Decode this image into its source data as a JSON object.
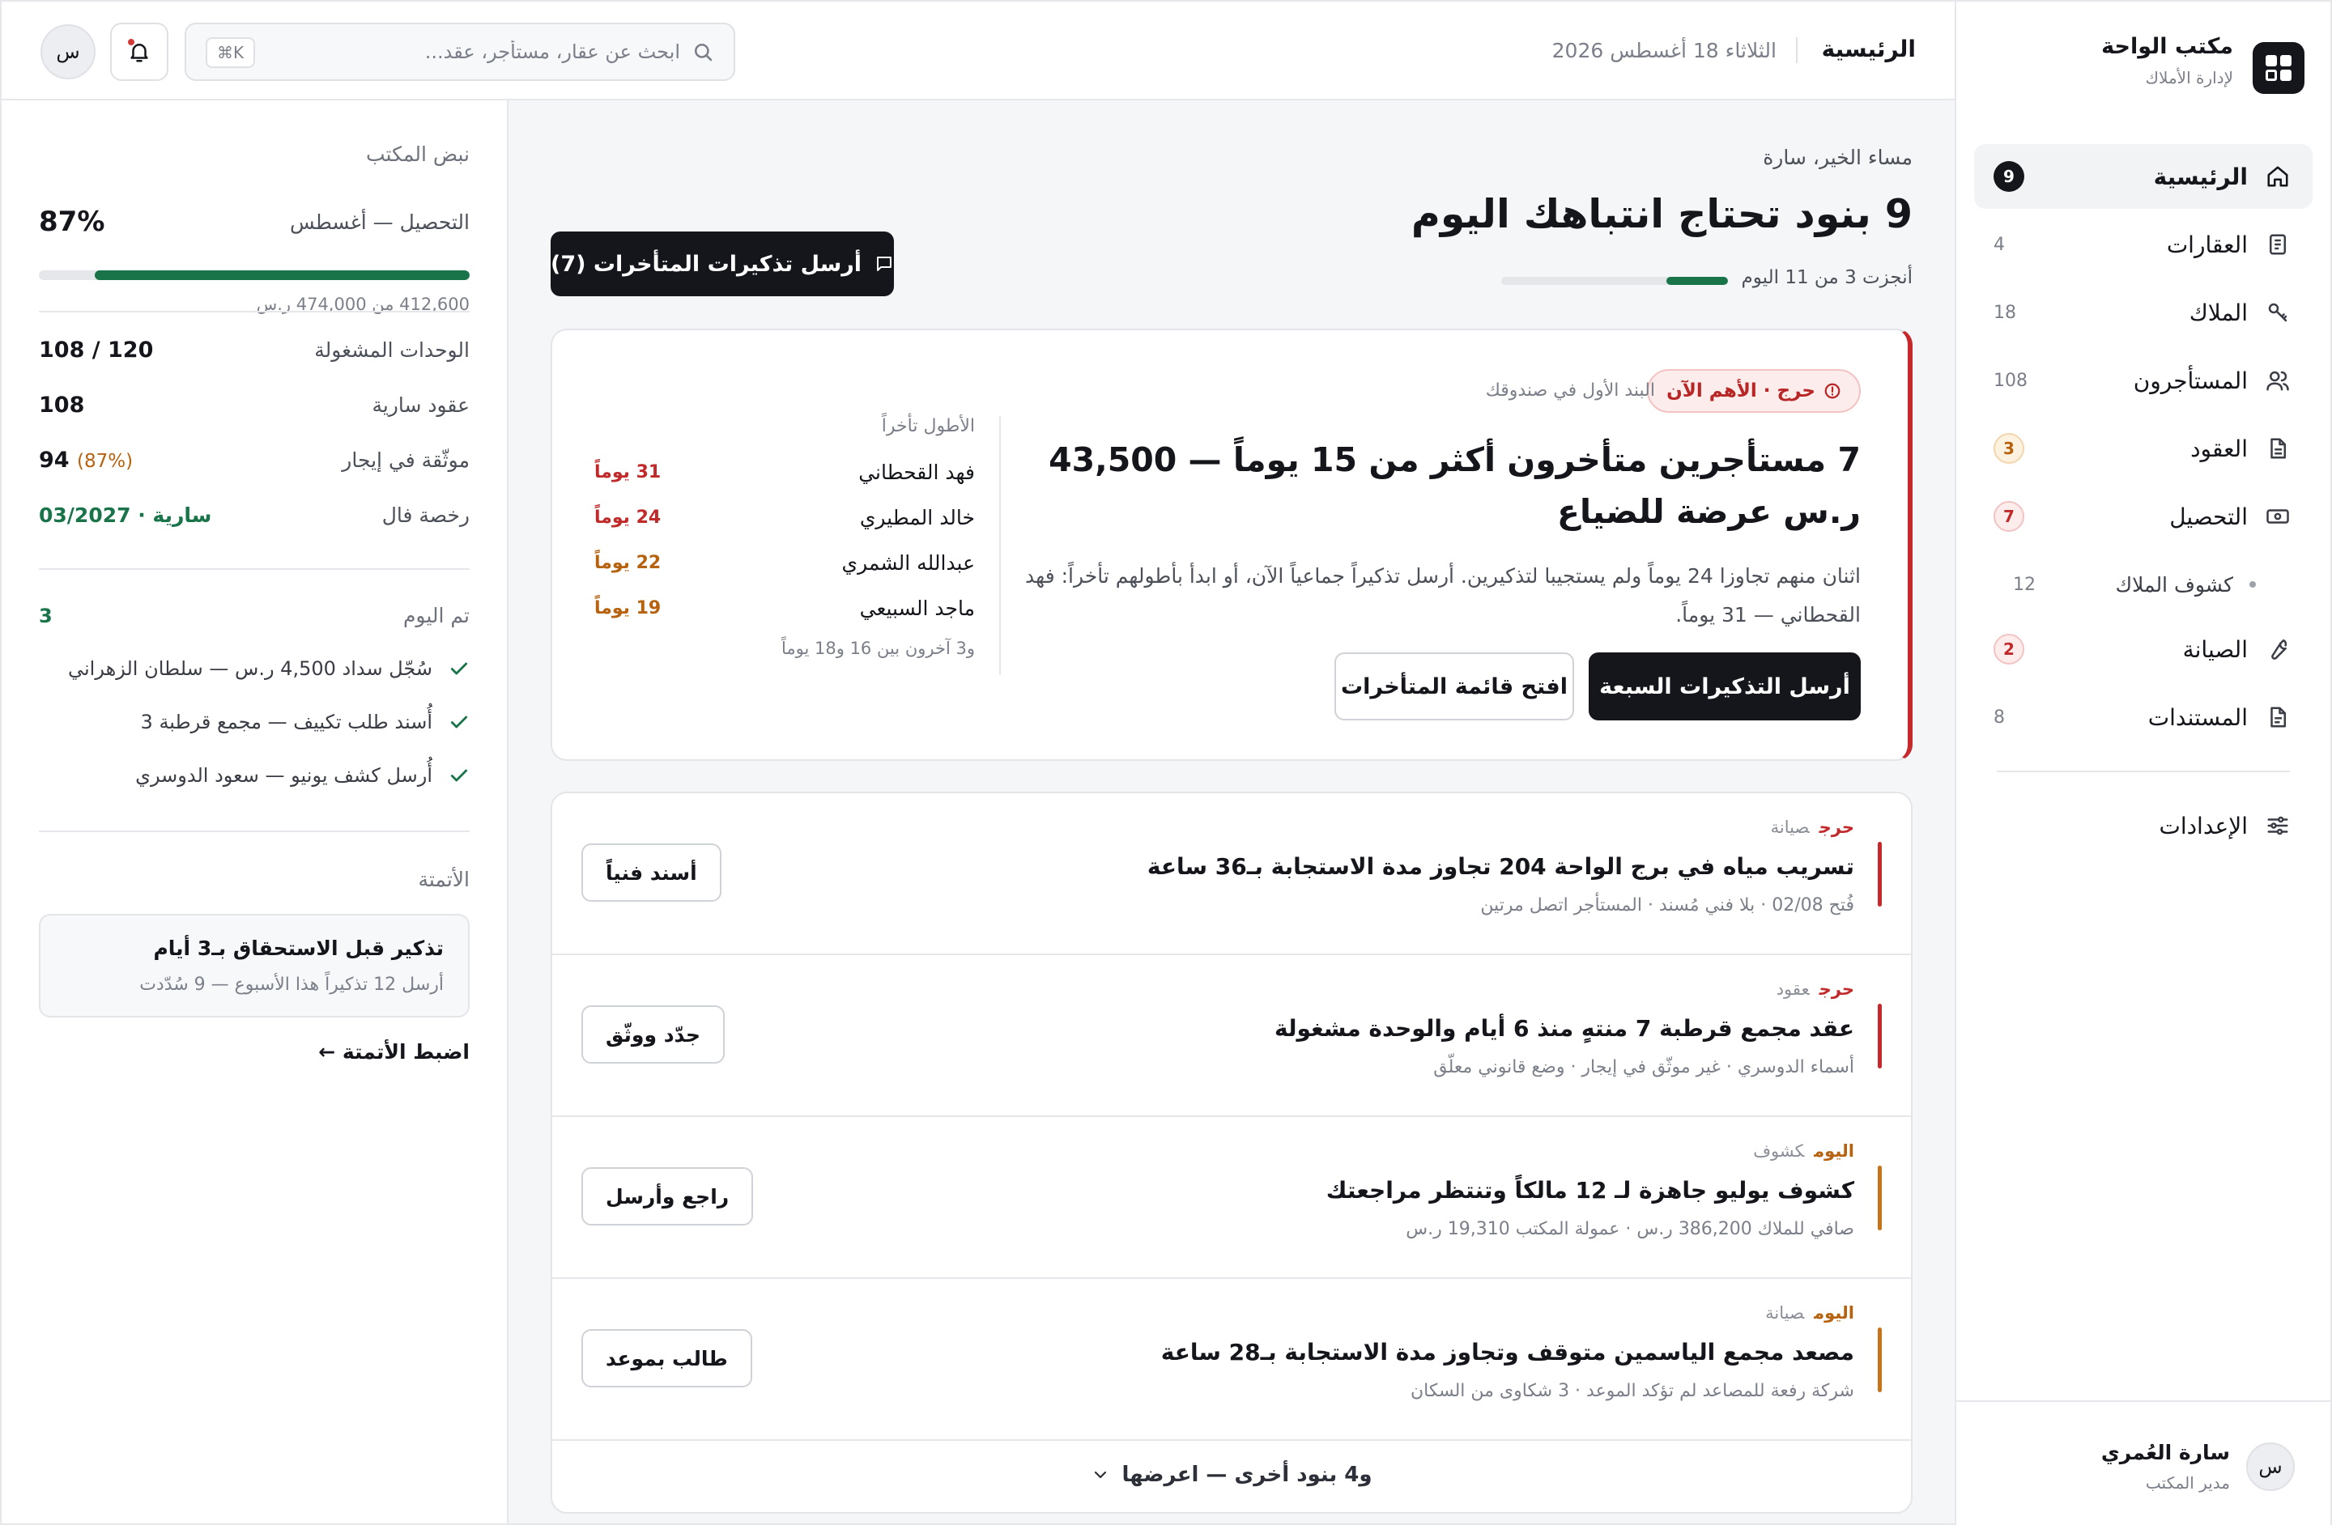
{
  "sidebar": {
    "brand_name": "مكتب الواحة",
    "brand_sub": "لإدارة الأملاك",
    "items": [
      {
        "label": "الرئيسية",
        "count": "9"
      },
      {
        "label": "العقارات",
        "count": "4"
      },
      {
        "label": "الملاك",
        "count": "18"
      },
      {
        "label": "المستأجرون",
        "count": "108"
      },
      {
        "label": "العقود",
        "count": "3"
      },
      {
        "label": "التحصيل",
        "count": "7"
      },
      {
        "label": "كشوف الملاك",
        "count": "12"
      },
      {
        "label": "الصيانة",
        "count": "2"
      },
      {
        "label": "المستندات",
        "count": "8"
      },
      {
        "label": "الإعدادات"
      }
    ],
    "profile": {
      "initial": "س",
      "name": "سارة العُمري",
      "role": "مدير المكتب"
    }
  },
  "header": {
    "crumb": "الرئيسية",
    "date": "الثلاثاء 18 أغسطس 2026",
    "search_placeholder": "ابحث عن عقار، مستأجر، عقد...",
    "shortcut": "⌘K",
    "avatar_initial": "س"
  },
  "main": {
    "greeting": "مساء الخير، سارة",
    "headline": "9 بنود تحتاج انتباهك اليوم",
    "progress_text": "أنجزت 3 من 11 اليوم",
    "progress_fraction": 0.2727,
    "remind_button": "أرسل تذكيرات المتأخرات (7)",
    "hero": {
      "tag": "حرج · الأهم الآن",
      "first_label": "البند الأول في صندوقك",
      "title": "7 مستأجرين متأخرون أكثر من 15 يوماً — 43,500 ر.س عرضة للضياع",
      "desc": "اثنان منهم تجاوزا 24 يوماً ولم يستجيبا لتذكيرين. أرسل تذكيراً جماعياً الآن، أو ابدأ بأطولهم تأخراً: فهد القحطاني — 31 يوماً.",
      "primary": "أرسل التذكيرات السبعة",
      "secondary": "افتح قائمة المتأخرات",
      "late_head": "الأطول تأخراً",
      "late": [
        {
          "name": "فهد القحطاني",
          "days": "31 يوماً"
        },
        {
          "name": "خالد المطيري",
          "days": "24 يوماً"
        },
        {
          "name": "عبدالله الشمري",
          "days": "22 يوماً"
        },
        {
          "name": "ماجد السبيعي",
          "days": "19 يوماً"
        }
      ],
      "late_foot": "و3 آخرون بين 16 و18 يوماً"
    },
    "tasks": [
      {
        "severity": "حرج",
        "category": "صيانة",
        "title": "تسريب مياه في برج الواحة 204 تجاوز مدة الاستجابة بـ36 ساعة",
        "sub": "فُتح 02/08 · بلا فني مُسند · المستأجر اتصل مرتين",
        "action": "أسند فنياً"
      },
      {
        "severity": "حرج",
        "category": "عقود",
        "title": "عقد مجمع قرطبة 7 منتهٍ منذ 6 أيام والوحدة مشغولة",
        "sub": "أسماء الدوسري · غير موثّق في إيجار · وضع قانوني معلّق",
        "action": "جدّد ووثّق"
      },
      {
        "severity": "اليوم",
        "category": "كشوف",
        "title": "كشوف يوليو جاهزة لـ 12 مالكاً وتنتظر مراجعتك",
        "sub": "صافي للملاك 386,200 ر.س · عمولة المكتب 19,310 ر.س",
        "action": "راجع وأرسل"
      },
      {
        "severity": "اليوم",
        "category": "صيانة",
        "title": "مصعد مجمع الياسمين متوقف وتجاوز مدة الاستجابة بـ28 ساعة",
        "sub": "شركة رفعة للمصاعد لم تؤكد الموعد · 3 شكاوى من السكان",
        "action": "طالب بموعد"
      }
    ],
    "more": "و4 بنود أخرى — اعرضها"
  },
  "pulse": {
    "title": "نبض المكتب",
    "collection_label": "التحصيل — أغسطس",
    "collection_pct": "87%",
    "collection_fraction": 0.87,
    "collection_sub": "412,600 من 474,000 ر.س",
    "rows": [
      {
        "k": "الوحدات المشغولة",
        "v": "108 / 120"
      },
      {
        "k": "عقود سارية",
        "v": "108"
      },
      {
        "k": "موثّقة في إيجار",
        "v": "94",
        "extra": "(87%)"
      },
      {
        "k": "رخصة فال",
        "v": "سارية · 03/2027"
      }
    ],
    "done_title": "تم اليوم",
    "done_count": "3",
    "done": [
      "سُجّل سداد 4,500 ر.س — سلطان الزهراني",
      "أُسند طلب تكييف — مجمع قرطبة 3",
      "أُرسل كشف يونيو — سعود الدوسري"
    ],
    "auto_title": "الأتمتة",
    "auto_card_title": "تذكير قبل الاستحقاق بـ3 أيام",
    "auto_card_sub": "أرسل 12 تذكيراً هذا الأسبوع — 9 سُدّدت",
    "auto_link": "اضبط الأتمتة ←"
  },
  "colors": {
    "accent_green": "#19744a",
    "critical": "#c6282b",
    "today": "#b7620f",
    "dark": "#14161c"
  }
}
